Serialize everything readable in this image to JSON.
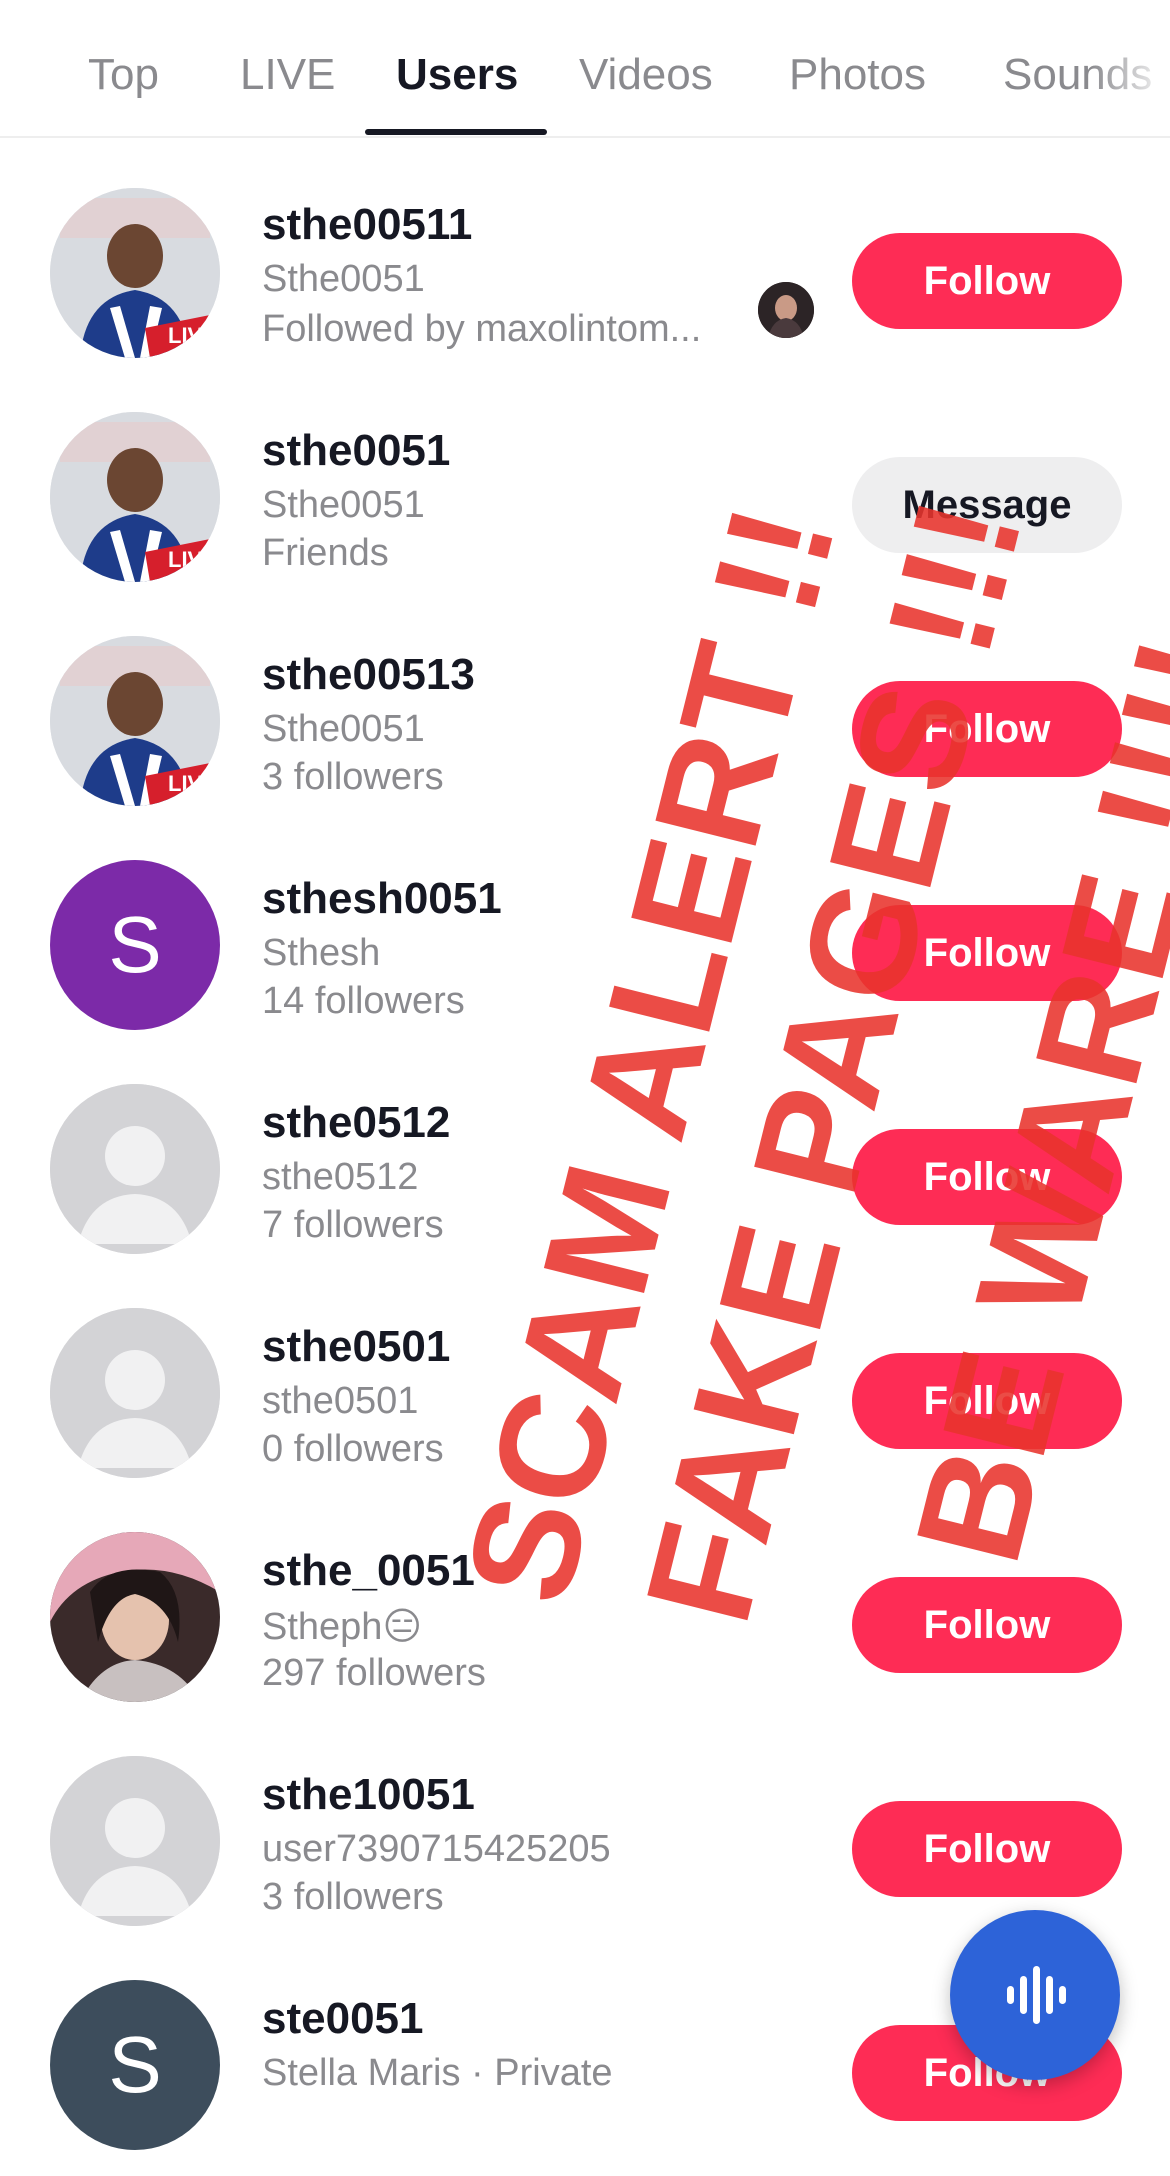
{
  "tabs": [
    "Top",
    "LIVE",
    "Users",
    "Videos",
    "Photos",
    "Sounds"
  ],
  "active_tab": "Users",
  "users": [
    {
      "username": "sthe00511",
      "display_name": "Sthe0051",
      "meta": "Followed by maxolintom...",
      "button": "Follow",
      "avatar": "photo-live"
    },
    {
      "username": "sthe0051",
      "display_name": "Sthe0051",
      "meta": "Friends",
      "button": "Message",
      "avatar": "photo-live"
    },
    {
      "username": "sthe00513",
      "display_name": "Sthe0051",
      "meta": "3 followers",
      "button": "Follow",
      "avatar": "photo-live"
    },
    {
      "username": "sthesh0051",
      "display_name": "Sthesh",
      "meta": "14 followers",
      "button": "Follow",
      "avatar": "letter",
      "avatar_letter": "S"
    },
    {
      "username": "sthe0512",
      "display_name": "sthe0512",
      "meta": "7 followers",
      "button": "Follow",
      "avatar": "default"
    },
    {
      "username": "sthe0501",
      "display_name": "sthe0501",
      "meta": "0 followers",
      "button": "Follow",
      "avatar": "default"
    },
    {
      "username": "sthe_0051",
      "display_name": "Stheph😑",
      "meta": "297 followers",
      "button": "Follow",
      "avatar": "photo"
    },
    {
      "username": "sthe10051",
      "display_name": "user7390715425205",
      "meta": "3 followers",
      "button": "Follow",
      "avatar": "default"
    },
    {
      "username": "ste0051",
      "display_name": "Stella Maris · Private",
      "meta": "",
      "button": "Follow",
      "avatar": "letter",
      "avatar_letter": "S"
    }
  ],
  "overlay": {
    "line1": "SCAM ALERT !!",
    "line2": "FAKE PAGES !!!",
    "line3": "BE WARE !!!!",
    "color": "#e8332c",
    "color_bang": "#e82010"
  },
  "fab_icon": "voice-search-icon",
  "colors": {
    "follow": "#fe2c55",
    "active_tab": "#161823",
    "muted": "#8a8a8e",
    "fab": "#2d63d8",
    "avatar_purple": "#7c2aa8",
    "avatar_slate": "#3d4d5c"
  }
}
